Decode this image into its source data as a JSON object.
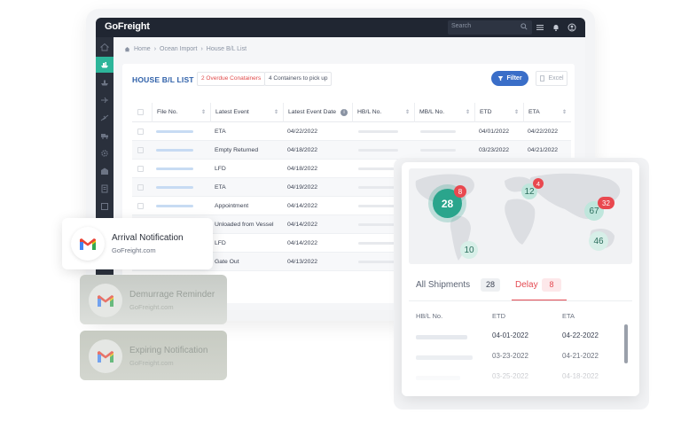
{
  "app": {
    "logo": "GoFreight",
    "search_placeholder": "Search",
    "breadcrumb": [
      "Home",
      "Ocean Import",
      "House B/L List"
    ],
    "list_title": "HOUSE B/L LIST",
    "badge_overdue": "2 Overdue Conatainers",
    "badge_pickup": "4 Containers to pick up",
    "filter_label": "Filter",
    "excel_label": "Excel",
    "columns": [
      "File No.",
      "Latest Event",
      "Latest Event Date",
      "HB/L No.",
      "MB/L No.",
      "ETD",
      "ETA"
    ],
    "rows": [
      {
        "event": "ETA",
        "date": "04/22/2022",
        "etd": "04/01/2022",
        "eta": "04/22/2022"
      },
      {
        "event": "Empty Returned",
        "date": "04/18/2022",
        "etd": "03/23/2022",
        "eta": "04/21/2022"
      },
      {
        "event": "LFD",
        "date": "04/18/2022",
        "etd": "",
        "eta": ""
      },
      {
        "event": "ETA",
        "date": "04/19/2022",
        "etd": "",
        "eta": ""
      },
      {
        "event": "Appointment",
        "date": "04/14/2022",
        "etd": "",
        "eta": ""
      },
      {
        "event": "Unloaded from Vessel",
        "date": "04/14/2022",
        "etd": "",
        "eta": ""
      },
      {
        "event": "LFD",
        "date": "04/14/2022",
        "etd": "",
        "eta": ""
      },
      {
        "event": "Gate Out",
        "date": "04/13/2022",
        "etd": "",
        "eta": ""
      }
    ]
  },
  "notifications": [
    {
      "title": "Arrival Notification",
      "sender": "GoFreight.com"
    },
    {
      "title": "Demurrage Reminder",
      "sender": "GoFreight.com"
    },
    {
      "title": "Expiring Notification",
      "sender": "GoFreight.com"
    }
  ],
  "shipments": {
    "map_bubbles": {
      "na_main": "28",
      "na_delay": "8",
      "eu_main": "12",
      "eu_delay": "4",
      "asia_main": "67",
      "asia_delay": "32",
      "sa_main": "10",
      "au_main": "46"
    },
    "tab_all_label": "All Shipments",
    "tab_all_count": "28",
    "tab_delay_label": "Delay",
    "tab_delay_count": "8",
    "col_hbl": "HB/L No.",
    "col_etd": "ETD",
    "col_eta": "ETA",
    "rows": [
      {
        "etd": "04-01-2022",
        "eta": "04-22-2022"
      },
      {
        "etd": "03-23-2022",
        "eta": "04-21-2022"
      },
      {
        "etd": "03-25-2022",
        "eta": "04-18-2022"
      }
    ],
    "colors": {
      "teal": "#2aa58c",
      "teal_light": "#bfe6dc",
      "red": "#e9484f",
      "blue": "#3a6ec8"
    }
  }
}
